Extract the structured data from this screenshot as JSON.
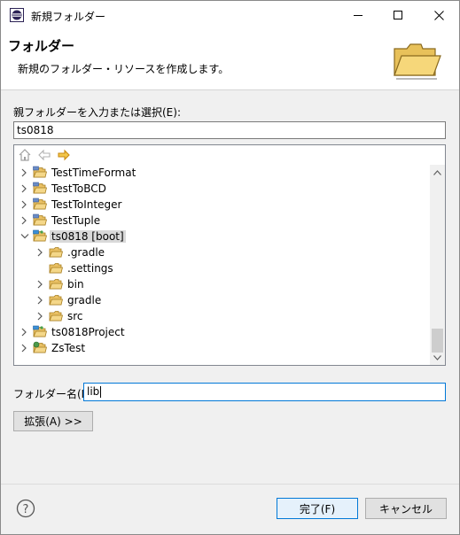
{
  "window": {
    "title": "新規フォルダー",
    "controls": {
      "minimize": "minimize-icon",
      "maximize": "maximize-icon",
      "close": "close-icon"
    }
  },
  "header": {
    "title": "フォルダー",
    "description": "新規のフォルダー・リソースを作成します。"
  },
  "parent": {
    "label": "親フォルダーを入力または選択(E):",
    "value": "ts0818"
  },
  "tree": {
    "toolbar": [
      "home-icon",
      "back-arrow-icon",
      "forward-arrow-icon"
    ],
    "items": [
      {
        "label": "TestTimeFormat",
        "level": 0,
        "expanded": false,
        "icon": "project-icon"
      },
      {
        "label": "TestToBCD",
        "level": 0,
        "expanded": false,
        "icon": "project-icon"
      },
      {
        "label": "TestToInteger",
        "level": 0,
        "expanded": false,
        "icon": "project-icon"
      },
      {
        "label": "TestTuple",
        "level": 0,
        "expanded": false,
        "icon": "project-icon"
      },
      {
        "label": "ts0818 [boot]",
        "level": 0,
        "expanded": true,
        "icon": "gradle-project-icon",
        "selected": true
      },
      {
        "label": ".gradle",
        "level": 1,
        "expanded": false,
        "icon": "folder-icon"
      },
      {
        "label": ".settings",
        "level": 1,
        "expanded": null,
        "icon": "folder-icon"
      },
      {
        "label": "bin",
        "level": 1,
        "expanded": false,
        "icon": "folder-icon"
      },
      {
        "label": "gradle",
        "level": 1,
        "expanded": false,
        "icon": "folder-icon"
      },
      {
        "label": "src",
        "level": 1,
        "expanded": false,
        "icon": "folder-icon"
      },
      {
        "label": "ts0818Project",
        "level": 0,
        "expanded": false,
        "icon": "gradle-project-icon"
      },
      {
        "label": "ZsTest",
        "level": 0,
        "expanded": false,
        "icon": "java-project-icon"
      }
    ]
  },
  "folder_name": {
    "label": "フォルダー名(N):",
    "value": "lib"
  },
  "buttons": {
    "advanced": "拡張(A) >>",
    "finish": "完了(F)",
    "cancel": "キャンセル"
  },
  "colors": {
    "accent": "#0078d7",
    "folder": "#e8b84a",
    "arrow": "#e7a52b"
  }
}
